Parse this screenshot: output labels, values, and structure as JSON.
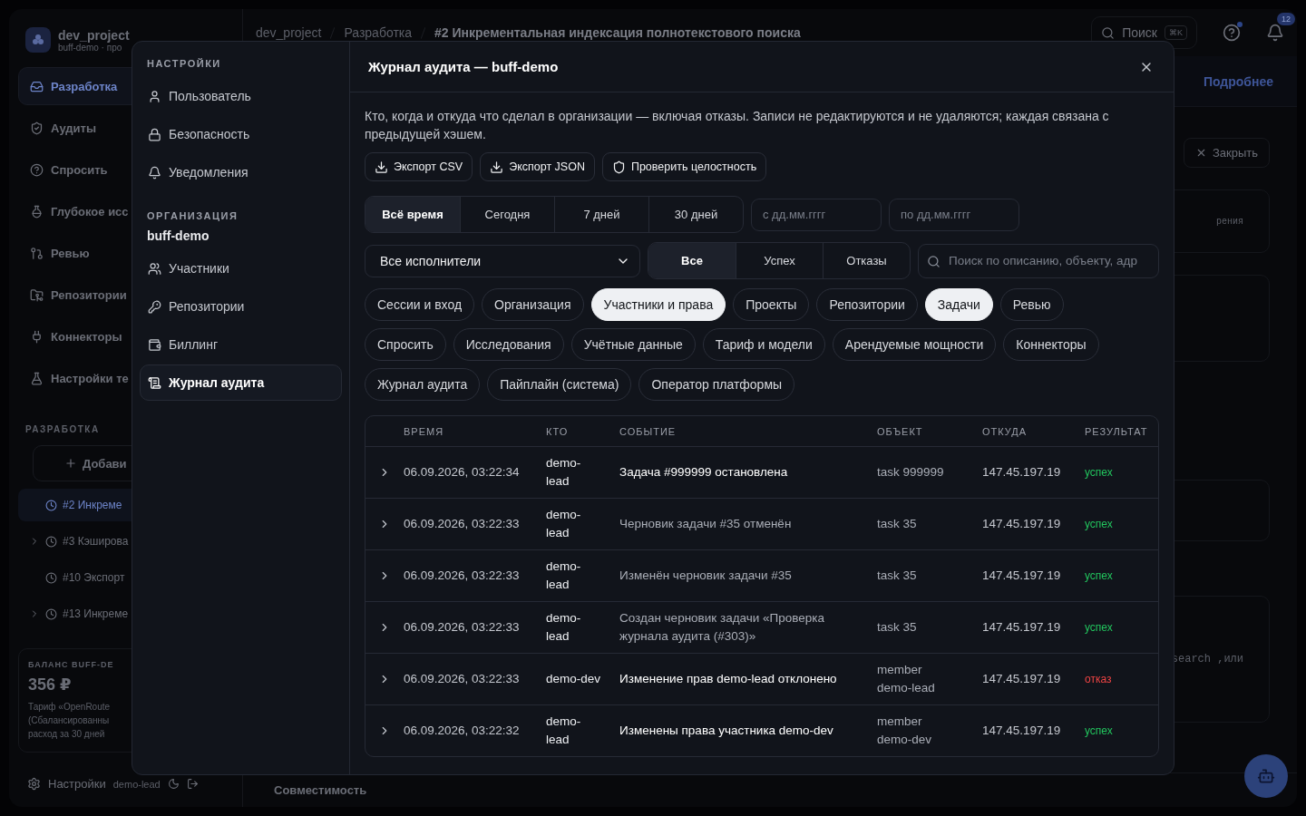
{
  "background": {
    "workspace": {
      "name": "dev_project",
      "subtitle": "buff-demo · про"
    },
    "nav": [
      {
        "label": "Разработка",
        "selected": true
      },
      {
        "label": "Аудиты",
        "selected": false
      },
      {
        "label": "Спросить",
        "selected": false
      },
      {
        "label": "Глубокое исс",
        "selected": false
      },
      {
        "label": "Ревью",
        "selected": false
      },
      {
        "label": "Репозитории",
        "selected": false
      },
      {
        "label": "Коннекторы",
        "selected": false
      },
      {
        "label": "Настройки те",
        "selected": false
      }
    ],
    "section_title": "РАЗРАБОТКА",
    "add_button": "Добави",
    "tasks": [
      {
        "label": "#2 Инкреме",
        "selected": true,
        "expandable": false
      },
      {
        "label": "#3 Кэширова",
        "selected": false,
        "expandable": true
      },
      {
        "label": "#10 Экспорт",
        "selected": false,
        "expandable": false
      },
      {
        "label": "#13 Инкреме",
        "selected": false,
        "expandable": true
      }
    ],
    "balance": {
      "title": "БАЛАНС BUFF-DE",
      "amount": "356 ₽",
      "lines": [
        "Тариф «OpenRoute",
        "(Сбалансированны",
        "расход за 30 дней"
      ]
    },
    "footer": {
      "settings": "Настройки",
      "user": "demo-lead"
    },
    "breadcrumb": [
      "dev_project",
      "Разработка",
      "#2 Инкрементальная индексация полнотекстового поиска"
    ],
    "search": {
      "placeholder": "Поиск",
      "shortcut": "⌘K"
    },
    "notifications_count": "12",
    "banner_link": "Подробнее",
    "close_button": "Закрыть",
    "fragments": [
      "рения",
      "search ,или"
    ],
    "bottom_tab": "Совместимость"
  },
  "modal": {
    "title": "Журнал аудита — buff-demo",
    "sidebar": [
      {
        "title": "НАСТРОЙКИ",
        "items": [
          {
            "label": "Пользователь",
            "selected": false
          },
          {
            "label": "Безопасность",
            "selected": false
          },
          {
            "label": "Уведомления",
            "selected": false
          }
        ]
      },
      {
        "title": "ОРГАНИЗАЦИЯ",
        "org": "buff-demo",
        "items": [
          {
            "label": "Участники",
            "selected": false
          },
          {
            "label": "Репозитории",
            "selected": false
          },
          {
            "label": "Биллинг",
            "selected": false
          },
          {
            "label": "Журнал аудита",
            "selected": true
          }
        ]
      }
    ],
    "description": "Кто, когда и откуда что сделал в организации — включая отказы. Записи не редактируются и не удаляются; каждая связана с предыдущей хэшем.",
    "actions": [
      {
        "label": "Экспорт CSV",
        "kind": "download"
      },
      {
        "label": "Экспорт JSON",
        "kind": "download"
      },
      {
        "label": "Проверить целостность",
        "kind": "verify"
      }
    ],
    "periods": [
      {
        "label": "Всё время",
        "selected": true
      },
      {
        "label": "Сегодня",
        "selected": false
      },
      {
        "label": "7 дней",
        "selected": false
      },
      {
        "label": "30 дней",
        "selected": false
      }
    ],
    "date_from": {
      "placeholder": "с дд.мм.гггг"
    },
    "date_to": {
      "placeholder": "по дд.мм.гггг"
    },
    "actor_select": "Все исполнители",
    "results": [
      {
        "label": "Все",
        "selected": true
      },
      {
        "label": "Успех",
        "selected": false
      },
      {
        "label": "Отказы",
        "selected": false
      }
    ],
    "search": {
      "placeholder": "Поиск по описанию, объекту, адр"
    },
    "categories": [
      {
        "label": "Сессии и вход",
        "selected": false
      },
      {
        "label": "Организация",
        "selected": false
      },
      {
        "label": "Участники и права",
        "selected": true
      },
      {
        "label": "Проекты",
        "selected": false
      },
      {
        "label": "Репозитории",
        "selected": false
      },
      {
        "label": "Задачи",
        "selected": true
      },
      {
        "label": "Ревью",
        "selected": false
      },
      {
        "label": "Спросить",
        "selected": false
      },
      {
        "label": "Исследования",
        "selected": false
      },
      {
        "label": "Учётные данные",
        "selected": false
      },
      {
        "label": "Тариф и модели",
        "selected": false
      },
      {
        "label": "Арендуемые мощности",
        "selected": false
      },
      {
        "label": "Коннекторы",
        "selected": false
      },
      {
        "label": "Журнал аудита",
        "selected": false
      },
      {
        "label": "Пайплайн (система)",
        "selected": false
      },
      {
        "label": "Оператор платформы",
        "selected": false
      }
    ],
    "table": {
      "columns": [
        "ВРЕМЯ",
        "КТО",
        "СОБЫТИЕ",
        "ОБЪЕКТ",
        "ОТКУДА",
        "РЕЗУЛЬТАТ"
      ],
      "rows": [
        {
          "time": "06.09.2026, 03:22:34",
          "who": "demo-lead",
          "event": "Задача #999999 остановлена",
          "emphasis": true,
          "object": "task 999999",
          "from": "147.45.197.19",
          "result": "успех",
          "color": "#22c55e"
        },
        {
          "time": "06.09.2026, 03:22:33",
          "who": "demo-lead",
          "event": "Черновик задачи #35 отменён",
          "emphasis": false,
          "object": "task 35",
          "from": "147.45.197.19",
          "result": "успех",
          "color": "#22c55e"
        },
        {
          "time": "06.09.2026, 03:22:33",
          "who": "demo-lead",
          "event": "Изменён черновик задачи #35",
          "emphasis": false,
          "object": "task 35",
          "from": "147.45.197.19",
          "result": "успех",
          "color": "#22c55e"
        },
        {
          "time": "06.09.2026, 03:22:33",
          "who": "demo-lead",
          "event": "Создан черновик задачи «Проверка журнала аудита (#303)»",
          "emphasis": false,
          "object": "task 35",
          "from": "147.45.197.19",
          "result": "успех",
          "color": "#22c55e"
        },
        {
          "time": "06.09.2026, 03:22:33",
          "who": "demo-dev",
          "event": "Изменение прав demo-lead отклонено",
          "emphasis": true,
          "object": "member demo-lead",
          "from": "147.45.197.19",
          "result": "отказ",
          "color": "#ef4444"
        },
        {
          "time": "06.09.2026, 03:22:32",
          "who": "demo-lead",
          "event": "Изменены права участника demo-dev",
          "emphasis": true,
          "object": "member demo-dev",
          "from": "147.45.197.19",
          "result": "успех",
          "color": "#22c55e"
        }
      ]
    }
  }
}
